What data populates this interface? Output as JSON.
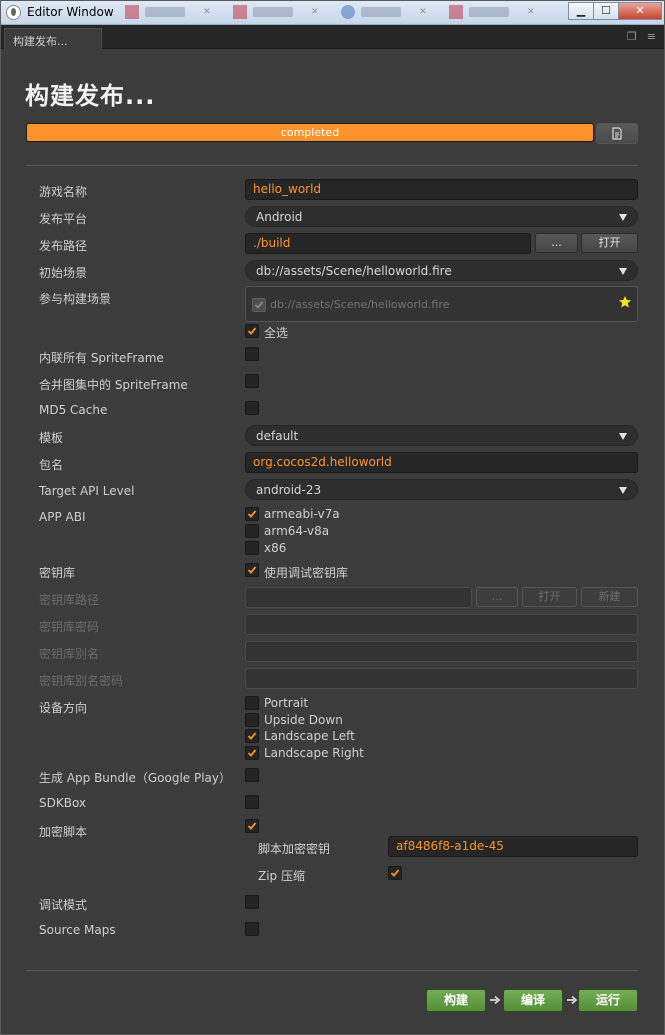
{
  "window": {
    "title": "Editor Window",
    "minimize": "▁",
    "maximize": "☐",
    "close": "✕"
  },
  "panel_tab": {
    "label": "构建发布..."
  },
  "page": {
    "title": "构建发布..."
  },
  "progress": {
    "value": 100,
    "text": "completed"
  },
  "form": {
    "game_name": {
      "label": "游戏名称",
      "value": "hello_world"
    },
    "platform": {
      "label": "发布平台",
      "value": "Android"
    },
    "build_path": {
      "label": "发布路径",
      "value": "./build",
      "browse": "...",
      "open": "打开"
    },
    "start_scene": {
      "label": "初始场景",
      "value": "db://assets/Scene/helloworld.fire"
    },
    "included_scenes": {
      "label": "参与构建场景",
      "scene": "db://assets/Scene/helloworld.fire",
      "select_all": "全选"
    },
    "inline_spriteframe": {
      "label": "内联所有 SpriteFrame"
    },
    "merge_spriteframe": {
      "label": "合并图集中的 SpriteFrame"
    },
    "md5_cache": {
      "label": "MD5 Cache"
    },
    "template": {
      "label": "模板",
      "value": "default"
    },
    "package_name": {
      "label": "包名",
      "value": "org.cocos2d.helloworld"
    },
    "target_api": {
      "label": "Target API Level",
      "value": "android-23"
    },
    "app_abi": {
      "label": "APP ABI",
      "options": [
        "armeabi-v7a",
        "arm64-v8a",
        "x86"
      ]
    },
    "keystore": {
      "label": "密钥库",
      "use_debug": "使用调试密钥库"
    },
    "keystore_path": {
      "label": "密钥库路径",
      "browse": "...",
      "open": "打开",
      "new": "新建"
    },
    "keystore_password": {
      "label": "密钥库密码"
    },
    "keystore_alias": {
      "label": "密钥库别名"
    },
    "keystore_alias_password": {
      "label": "密钥库别名密码"
    },
    "orientation": {
      "label": "设备方向",
      "options": [
        "Portrait",
        "Upside Down",
        "Landscape Left",
        "Landscape Right"
      ]
    },
    "app_bundle": {
      "label": "生成 App Bundle（Google Play）"
    },
    "sdkbox": {
      "label": "SDKBox"
    },
    "encrypt_js": {
      "label": "加密脚本",
      "key_label": "脚本加密密钥",
      "key_value": "af8486f8-a1de-45",
      "zip_label": "Zip 压缩"
    },
    "debug": {
      "label": "调试模式"
    },
    "source_maps": {
      "label": "Source Maps"
    }
  },
  "actions": {
    "build": "构建",
    "compile": "编译",
    "run": "运行"
  },
  "colors": {
    "accent": "#fd942b",
    "green_button": "#63a046",
    "background": "#3c3c3c"
  }
}
